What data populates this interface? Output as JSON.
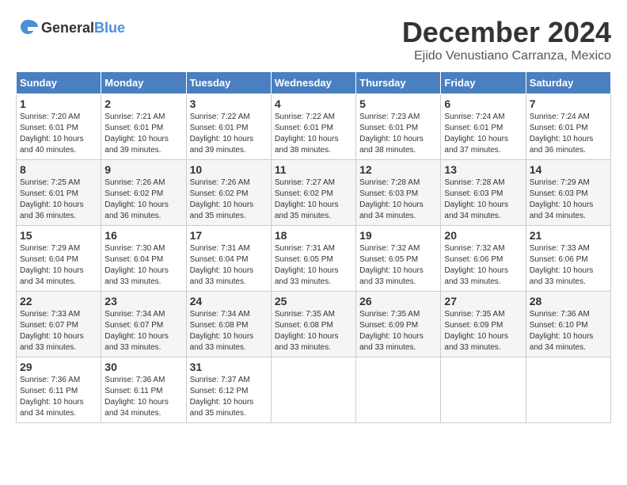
{
  "logo": {
    "text_general": "General",
    "text_blue": "Blue"
  },
  "title": "December 2024",
  "subtitle": "Ejido Venustiano Carranza, Mexico",
  "weekdays": [
    "Sunday",
    "Monday",
    "Tuesday",
    "Wednesday",
    "Thursday",
    "Friday",
    "Saturday"
  ],
  "weeks": [
    [
      {
        "day": "1",
        "sunrise": "7:20 AM",
        "sunset": "6:01 PM",
        "daylight": "10 hours and 40 minutes."
      },
      {
        "day": "2",
        "sunrise": "7:21 AM",
        "sunset": "6:01 PM",
        "daylight": "10 hours and 39 minutes."
      },
      {
        "day": "3",
        "sunrise": "7:22 AM",
        "sunset": "6:01 PM",
        "daylight": "10 hours and 39 minutes."
      },
      {
        "day": "4",
        "sunrise": "7:22 AM",
        "sunset": "6:01 PM",
        "daylight": "10 hours and 38 minutes."
      },
      {
        "day": "5",
        "sunrise": "7:23 AM",
        "sunset": "6:01 PM",
        "daylight": "10 hours and 38 minutes."
      },
      {
        "day": "6",
        "sunrise": "7:24 AM",
        "sunset": "6:01 PM",
        "daylight": "10 hours and 37 minutes."
      },
      {
        "day": "7",
        "sunrise": "7:24 AM",
        "sunset": "6:01 PM",
        "daylight": "10 hours and 36 minutes."
      }
    ],
    [
      {
        "day": "8",
        "sunrise": "7:25 AM",
        "sunset": "6:01 PM",
        "daylight": "10 hours and 36 minutes."
      },
      {
        "day": "9",
        "sunrise": "7:26 AM",
        "sunset": "6:02 PM",
        "daylight": "10 hours and 36 minutes."
      },
      {
        "day": "10",
        "sunrise": "7:26 AM",
        "sunset": "6:02 PM",
        "daylight": "10 hours and 35 minutes."
      },
      {
        "day": "11",
        "sunrise": "7:27 AM",
        "sunset": "6:02 PM",
        "daylight": "10 hours and 35 minutes."
      },
      {
        "day": "12",
        "sunrise": "7:28 AM",
        "sunset": "6:03 PM",
        "daylight": "10 hours and 34 minutes."
      },
      {
        "day": "13",
        "sunrise": "7:28 AM",
        "sunset": "6:03 PM",
        "daylight": "10 hours and 34 minutes."
      },
      {
        "day": "14",
        "sunrise": "7:29 AM",
        "sunset": "6:03 PM",
        "daylight": "10 hours and 34 minutes."
      }
    ],
    [
      {
        "day": "15",
        "sunrise": "7:29 AM",
        "sunset": "6:04 PM",
        "daylight": "10 hours and 34 minutes."
      },
      {
        "day": "16",
        "sunrise": "7:30 AM",
        "sunset": "6:04 PM",
        "daylight": "10 hours and 33 minutes."
      },
      {
        "day": "17",
        "sunrise": "7:31 AM",
        "sunset": "6:04 PM",
        "daylight": "10 hours and 33 minutes."
      },
      {
        "day": "18",
        "sunrise": "7:31 AM",
        "sunset": "6:05 PM",
        "daylight": "10 hours and 33 minutes."
      },
      {
        "day": "19",
        "sunrise": "7:32 AM",
        "sunset": "6:05 PM",
        "daylight": "10 hours and 33 minutes."
      },
      {
        "day": "20",
        "sunrise": "7:32 AM",
        "sunset": "6:06 PM",
        "daylight": "10 hours and 33 minutes."
      },
      {
        "day": "21",
        "sunrise": "7:33 AM",
        "sunset": "6:06 PM",
        "daylight": "10 hours and 33 minutes."
      }
    ],
    [
      {
        "day": "22",
        "sunrise": "7:33 AM",
        "sunset": "6:07 PM",
        "daylight": "10 hours and 33 minutes."
      },
      {
        "day": "23",
        "sunrise": "7:34 AM",
        "sunset": "6:07 PM",
        "daylight": "10 hours and 33 minutes."
      },
      {
        "day": "24",
        "sunrise": "7:34 AM",
        "sunset": "6:08 PM",
        "daylight": "10 hours and 33 minutes."
      },
      {
        "day": "25",
        "sunrise": "7:35 AM",
        "sunset": "6:08 PM",
        "daylight": "10 hours and 33 minutes."
      },
      {
        "day": "26",
        "sunrise": "7:35 AM",
        "sunset": "6:09 PM",
        "daylight": "10 hours and 33 minutes."
      },
      {
        "day": "27",
        "sunrise": "7:35 AM",
        "sunset": "6:09 PM",
        "daylight": "10 hours and 33 minutes."
      },
      {
        "day": "28",
        "sunrise": "7:36 AM",
        "sunset": "6:10 PM",
        "daylight": "10 hours and 34 minutes."
      }
    ],
    [
      {
        "day": "29",
        "sunrise": "7:36 AM",
        "sunset": "6:11 PM",
        "daylight": "10 hours and 34 minutes."
      },
      {
        "day": "30",
        "sunrise": "7:36 AM",
        "sunset": "6:11 PM",
        "daylight": "10 hours and 34 minutes."
      },
      {
        "day": "31",
        "sunrise": "7:37 AM",
        "sunset": "6:12 PM",
        "daylight": "10 hours and 35 minutes."
      },
      null,
      null,
      null,
      null
    ]
  ],
  "labels": {
    "sunrise": "Sunrise: ",
    "sunset": "Sunset: ",
    "daylight": "Daylight: "
  }
}
